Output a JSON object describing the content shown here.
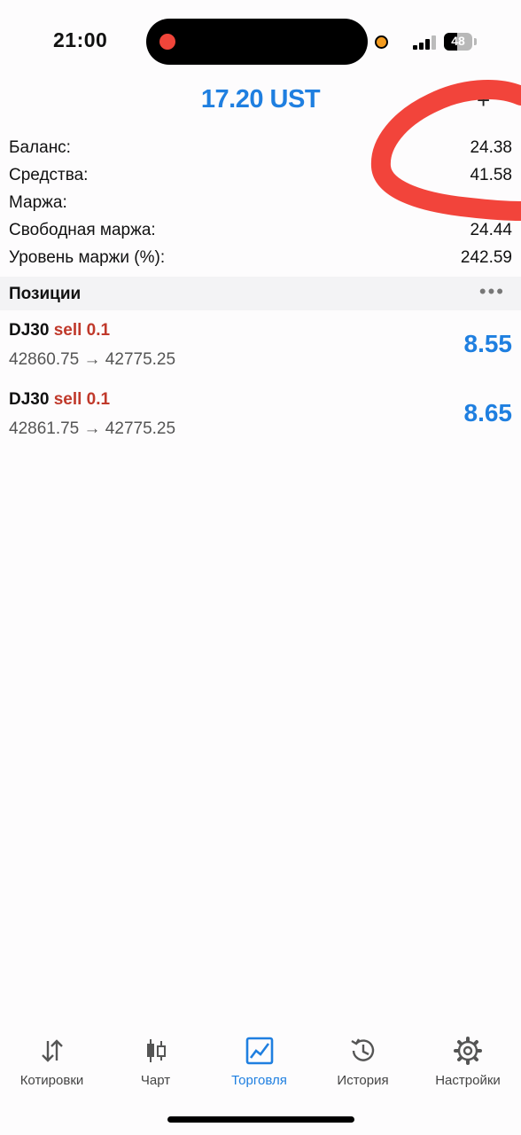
{
  "status_bar": {
    "time": "21:00",
    "battery": "48"
  },
  "header": {
    "title": "17.20 UST",
    "add_icon": "plus-icon"
  },
  "account": [
    {
      "label": "Баланс:",
      "value": "24.38"
    },
    {
      "label": "Средства:",
      "value": "41.58"
    },
    {
      "label": "Маржа:",
      "value": ""
    },
    {
      "label": "Свободная маржа:",
      "value": "24.44"
    },
    {
      "label": "Уровень маржи (%):",
      "value": "242.59"
    }
  ],
  "positions_section": {
    "title": "Позиции",
    "more_icon": "more-dots-icon"
  },
  "positions": [
    {
      "symbol": "DJ30",
      "side": "sell 0.1",
      "prices": "42860.75 → 42775.25",
      "profit": "8.55"
    },
    {
      "symbol": "DJ30",
      "side": "sell 0.1",
      "prices": "42861.75 → 42775.25",
      "profit": "8.65"
    }
  ],
  "tabs": [
    {
      "label": "Котировки",
      "icon": "quotes-arrows-icon",
      "active": false
    },
    {
      "label": "Чарт",
      "icon": "candlestick-chart-icon",
      "active": false
    },
    {
      "label": "Торговля",
      "icon": "trade-chart-icon",
      "active": true
    },
    {
      "label": "История",
      "icon": "history-clock-icon",
      "active": false
    },
    {
      "label": "Настройки",
      "icon": "settings-gear-icon",
      "active": false
    }
  ],
  "colors": {
    "accent": "#1f7fe0",
    "sell": "#c0392b",
    "annotation": "#f2443b"
  }
}
